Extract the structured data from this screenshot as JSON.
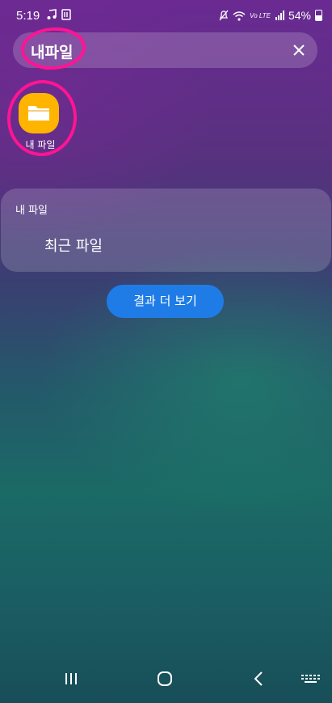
{
  "status_bar": {
    "time": "5:19",
    "network_label": "Vo LTE",
    "battery": "54%",
    "icons": [
      "music-note-icon",
      "storage-icon",
      "mute-icon",
      "wifi-icon",
      "signal-icon",
      "battery-icon"
    ]
  },
  "search": {
    "query": "내파일",
    "clear_icon": "close-icon"
  },
  "app_result": {
    "label": "내 파일",
    "icon": "folder-icon",
    "icon_color": "#ffb400"
  },
  "card": {
    "title": "내 파일",
    "item": "최근 파일"
  },
  "more_button": {
    "label": "결과 더 보기",
    "color": "#1f7ce6"
  },
  "nav": {
    "icons": [
      "recent-apps-icon",
      "home-icon",
      "back-icon",
      "keyboard-icon"
    ]
  },
  "annotation_color": "#ff1493"
}
